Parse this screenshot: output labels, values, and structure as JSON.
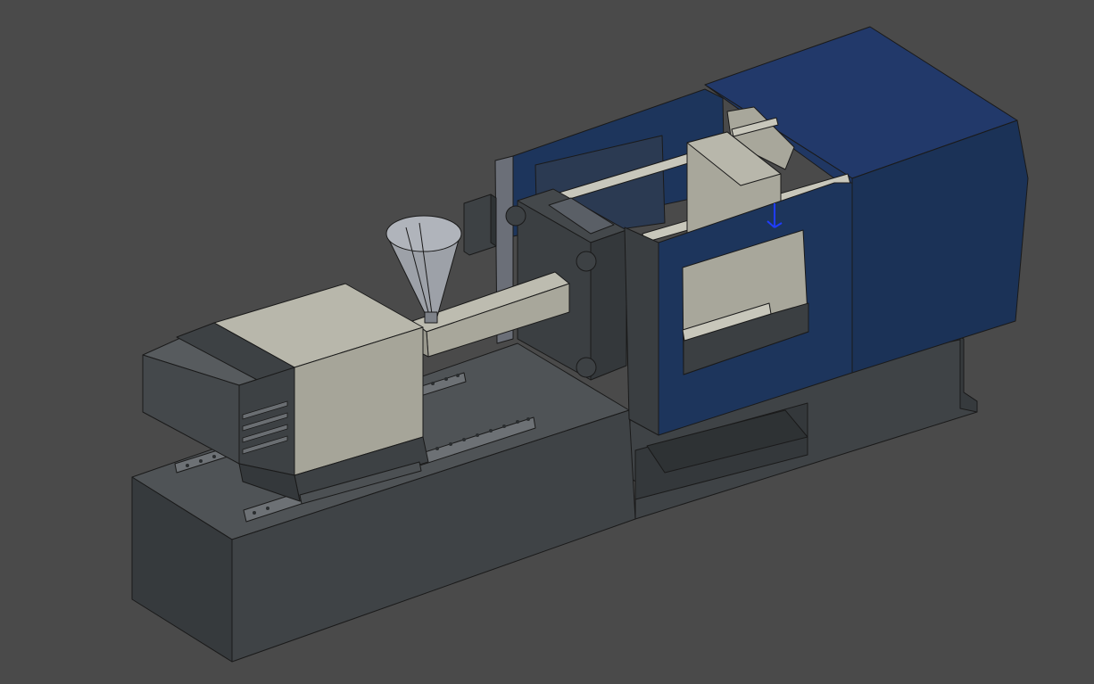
{
  "viewport": {
    "background": "#4a4a4a",
    "model": "injection-molding-machine"
  },
  "colors": {
    "base_top": "#4f5356",
    "base_front": "#3f4346",
    "base_side": "#363a3d",
    "housing_light": "#a6a599",
    "housing_light_top": "#b8b7ab",
    "housing_dark": "#3d4144",
    "barrel": "#b2b1a5",
    "blue_guard": "#1d355c",
    "blue_guard_dark": "#172b4c",
    "rod": "#c8c7bb",
    "platen": "#3b3f42",
    "hopper": "#9da1a8",
    "rail": "#6d7175",
    "axis_indicator": "#1f3cff"
  },
  "icons": {
    "axis_indicator": "axis-triad-icon"
  }
}
